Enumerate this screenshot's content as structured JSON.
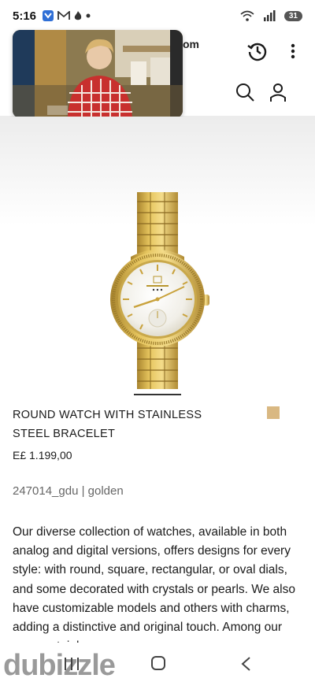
{
  "status_bar": {
    "time": "5:16",
    "battery": "31"
  },
  "header": {
    "domain_fragment": "om"
  },
  "product": {
    "title": "ROUND WATCH WITH STAINLESS STEEL BRACELET",
    "price": "E£ 1.199,00",
    "reference": "247014_gdu  |  golden",
    "swatch_color": "#d9b882",
    "description": "Our diverse collection of watches, available in both analog and digital versions, offers designs for every style: with round, square, rectangular, or oval dials, and some decorated with crystals or pearls. We also have customizable models and others with charms, adding a distinctive and original touch. Among our range, stainless"
  },
  "watermark": {
    "text": "dubizzle"
  },
  "icons": {
    "history": "history-icon",
    "menu": "more-vert-icon",
    "search": "search-icon",
    "account": "account-icon",
    "nav_recent": "recent-apps-icon",
    "nav_home": "home-icon",
    "nav_back": "back-icon"
  }
}
